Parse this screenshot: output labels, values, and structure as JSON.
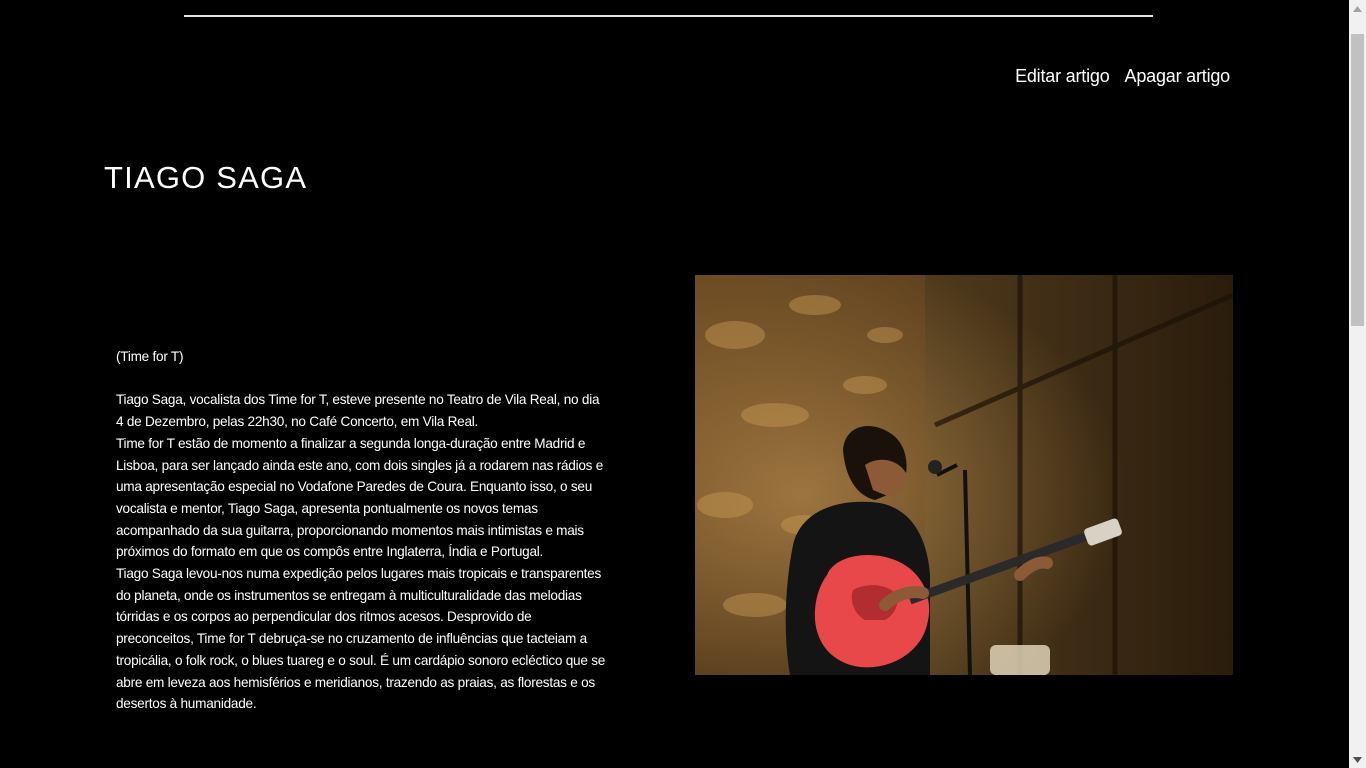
{
  "header": {
    "actions": {
      "edit_label": "Editar artigo",
      "delete_label": "Apagar artigo"
    }
  },
  "article": {
    "title": "TIAGO SAGA",
    "paragraphs": [
      "(Time for T)",
      "Tiago Saga, vocalista dos Time for T, esteve presente no Teatro de Vila Real, no dia 4 de Dezembro, pelas 22h30, no Café Concerto, em Vila Real.",
      "Time for T estão de momento a finalizar a segunda longa-duração entre Madrid e Lisboa, para ser lançado ainda este ano, com dois singles já a rodarem nas rádios e uma apresentação especial no Vodafone Paredes de Coura. Enquanto isso, o seu vocalista e mentor, Tiago Saga, apresenta pontualmente os novos temas acompanhado da sua guitarra, proporcionando momentos mais intimistas e mais próximos do formato em que os compôs entre Inglaterra, Índia e Portugal.",
      "Tiago Saga levou-nos numa expedição pelos lugares mais tropicais e transparentes do planeta, onde os instrumentos se entregam à multiculturalidade das melodias tórridas e os corpos ao perpendicular dos ritmos acesos. Desprovido de preconceitos, Time for T debruça-se no cruzamento de influências que tacteiam a tropicália, o folk rock, o blues tuareg e o soul. É um cardápio sonoro ecléctico que se abre em leveza aos hemisférios e meridianos, trazendo as praias, as florestas e os desertos à humanidade."
    ]
  },
  "icons": {
    "scroll_up": "chevron-up-icon",
    "scroll_down": "chevron-down-icon"
  },
  "colors": {
    "background": "#000000",
    "text": "#ffffff",
    "rule": "#e6e6e6",
    "guitar": "#e8484a"
  }
}
